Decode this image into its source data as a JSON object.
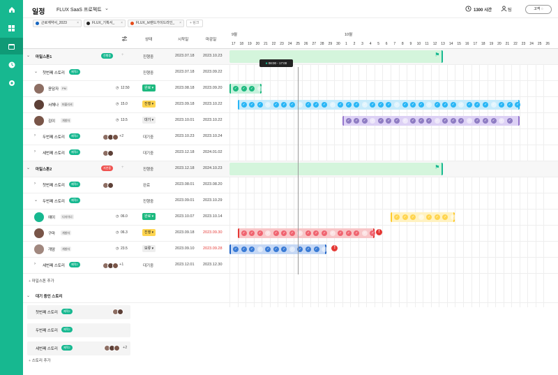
{
  "header": {
    "title": "일정",
    "project": "FLUX SaaS 프로젝트",
    "hours": "1300 시간",
    "team": "팀",
    "contact": "고객"
  },
  "tabs": [
    {
      "label": "근로계약서_2023",
      "color": "#1565c0"
    },
    {
      "label": "FLUX_기획서_",
      "color": "#222"
    },
    {
      "label": "FLUX_브랜드가이드라인_",
      "color": "#e64a19"
    }
  ],
  "tab_add": "+ 링크",
  "columns": {
    "status": "상태",
    "start": "시작일",
    "end": "마감일"
  },
  "months": [
    "9월",
    "10월"
  ],
  "days": [
    "17",
    "18",
    "19",
    "20",
    "21",
    "22",
    "23",
    "24",
    "25",
    "26",
    "27",
    "28",
    "29",
    "30",
    "1",
    "2",
    "3",
    "4",
    "5",
    "6",
    "7",
    "8",
    "9",
    "10",
    "11",
    "12",
    "13",
    "14",
    "15",
    "16",
    "17",
    "18",
    "19",
    "20",
    "21",
    "22",
    "23",
    "24",
    "25",
    "26"
  ],
  "tooltip": "08:00 - 17:00",
  "milestones": [
    {
      "name": "마일스톤1",
      "badge": "진행중",
      "status": "진행중",
      "start": "2023.07.18",
      "end": "2023.10.23",
      "stories": [
        {
          "name": "첫번째 스토리",
          "badge": "제작2",
          "status": "진행중",
          "start": "2023.07.18",
          "end": "2023.09.22",
          "expanded": true,
          "members": [
            {
              "name": "윤담자",
              "role": "PM",
              "hours": "12.50",
              "stat": "완료",
              "start": "2023.08.18",
              "end": "2023.09.20"
            },
            {
              "name": "서해나",
              "role": "퍼블리셔",
              "hours": "15.0",
              "stat": "진행",
              "start": "2023.09.18",
              "end": "2023.10.22"
            },
            {
              "name": "김이",
              "role": "개발자",
              "hours": "13.5",
              "stat": "대기",
              "start": "2023.10.01",
              "end": "2023.10.22"
            }
          ]
        },
        {
          "name": "두번째 스토리",
          "badge": "제작2",
          "more": "+2",
          "status": "대기중",
          "start": "2023.10.23",
          "end": "2023.10.24"
        },
        {
          "name": "세번째 스토리",
          "badge": "제작2",
          "status": "대기중",
          "start": "2023.12.18",
          "end": "2024.01.02"
        }
      ]
    },
    {
      "name": "마일스톤2",
      "badge": "지연중",
      "status": "진행중",
      "start": "2023.12.18",
      "end": "2024.10.23",
      "stories": [
        {
          "name": "첫번째 스토리",
          "badge": "제작2",
          "status": "완료",
          "start": "2023.08.01",
          "end": "2023.08.20"
        },
        {
          "name": "두번째 스토리",
          "badge": "제작2",
          "status": "진행중",
          "start": "2023.09.01",
          "end": "2023.10.29",
          "expanded": true,
          "members": [
            {
              "name": "예이",
              "role": "디자이너",
              "hours": "06.0",
              "stat": "완료",
              "start": "2023.10.07",
              "end": "2023.10.14"
            },
            {
              "name": "구마",
              "role": "개발자",
              "hours": "06.3",
              "stat": "진행",
              "start": "2023.09.18",
              "end": "2023.09.30",
              "late": true
            },
            {
              "name": "개암",
              "role": "개발자",
              "hours": "23.5",
              "stat": "보류",
              "start": "2023.09.10",
              "end": "2023.09.28",
              "late": true
            }
          ]
        },
        {
          "name": "세번째 스토리",
          "badge": "제작2",
          "more": "+1",
          "status": "대기중",
          "start": "2023.12.01",
          "end": "2023.12.30"
        }
      ]
    }
  ],
  "add_milestone": "마일스톤 추가",
  "waiting": {
    "title": "대기 중인 스토리",
    "items": [
      {
        "name": "첫번째 스토리",
        "badge": "제작2"
      },
      {
        "name": "두번째 스토리",
        "badge": "제작2"
      },
      {
        "name": "세번째 스토리",
        "badge": "제작2",
        "more": "+2"
      }
    ],
    "add": "스토리 추가"
  },
  "colors": {
    "accent": "#17b890",
    "done": "#1db97f",
    "progress": "#ffd54f",
    "wait": "#bbbbbb",
    "delay": "#ef5350"
  }
}
